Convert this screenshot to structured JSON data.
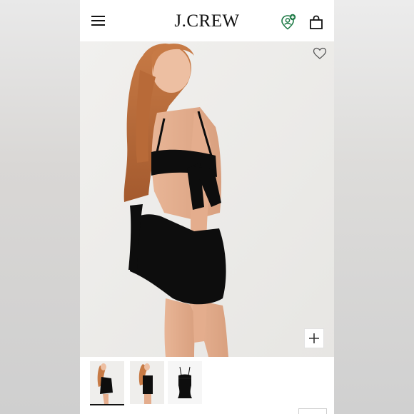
{
  "header": {
    "logo_text": "J.CREW"
  },
  "icons": {
    "menu": "menu-icon",
    "account": "account-icon",
    "bag": "shopping-bag-icon",
    "favorite": "heart-icon",
    "zoom": "plus-icon"
  },
  "gallery": {
    "thumbnail_count": 3,
    "active_index": 0
  },
  "colors": {
    "accent_green": "#1e7a46",
    "swimsuit": "#0d0d0d"
  }
}
